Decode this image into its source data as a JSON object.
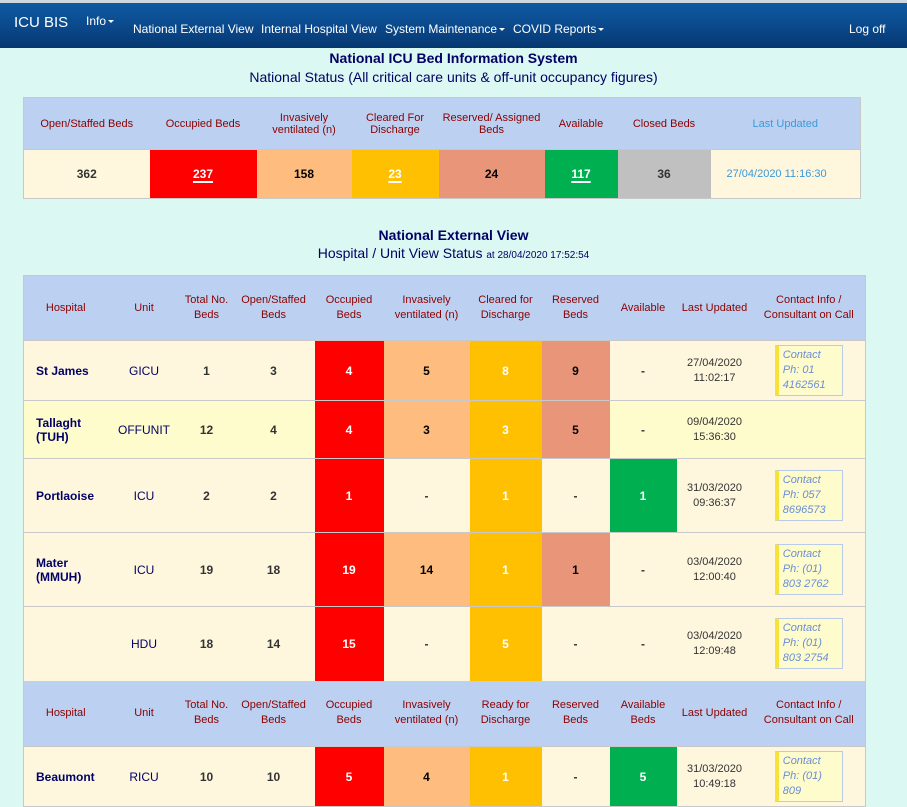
{
  "nav": {
    "brand": "ICU BIS",
    "items": [
      {
        "label": "Info",
        "dropdown": true
      },
      {
        "label": "National External View",
        "dropdown": false
      },
      {
        "label": "Internal Hospital View",
        "dropdown": false
      },
      {
        "label": "System Maintenance",
        "dropdown": true
      },
      {
        "label": "COVID Reports",
        "dropdown": true
      }
    ],
    "logoff": "Log off"
  },
  "national": {
    "title": "National ICU Bed Information System",
    "subtitle": "National Status (All critical care units & off-unit occupancy figures)",
    "headers": {
      "open_staffed": "Open/Staffed Beds",
      "occupied": "Occupied Beds",
      "ventilated": "Invasively ventilated (n)",
      "cleared": "Cleared For Discharge",
      "reserved": "Reserved/ Assigned Beds",
      "available": "Available",
      "closed": "Closed Beds",
      "last_updated": "Last Updated"
    },
    "values": {
      "open_staffed": "362",
      "occupied": "237",
      "ventilated": "158",
      "cleared": "23",
      "reserved": "24",
      "available": "117",
      "closed": "36",
      "last_updated": "27/04/2020 11:16:30"
    }
  },
  "external": {
    "title": "National External View",
    "subtitle": "Hospital / Unit View Status",
    "timestamp": "at 28/04/2020 17:52:54",
    "headers1": [
      "Hospital",
      "Unit",
      "Total No. Beds",
      "Open/Staffed Beds",
      "Occupied Beds",
      "Invasively ventilated (n)",
      "Cleared for Discharge",
      "Reserved Beds",
      "Available",
      "Last Updated",
      "Contact Info / Consultant on Call"
    ],
    "headers2": [
      "Hospital",
      "Unit",
      "Total No. Beds",
      "Open/Staffed Beds",
      "Occupied Beds",
      "Invasively ventilated (n)",
      "Ready for Discharge",
      "Reserved Beds",
      "Available Beds",
      "Last Updated",
      "Contact Info / Consultant on Call"
    ],
    "rows": [
      {
        "hospital": "St James",
        "unit": "GICU",
        "total": "1",
        "open": "3",
        "occupied": "4",
        "ventilated": "5",
        "cleared": "8",
        "reserved": "9",
        "available": "-",
        "updated_date": "27/04/2020",
        "updated_time": "11:02:17",
        "contact": "Contact Ph: 01 4162561"
      },
      {
        "hospital": "Tallaght (TUH)",
        "unit": "OFFUNIT",
        "total": "12",
        "open": "4",
        "occupied": "4",
        "ventilated": "3",
        "cleared": "3",
        "reserved": "5",
        "available": "-",
        "updated_date": "09/04/2020",
        "updated_time": "15:36:30",
        "contact": ""
      },
      {
        "hospital": "Portlaoise",
        "unit": "ICU",
        "total": "2",
        "open": "2",
        "occupied": "1",
        "ventilated": "-",
        "cleared": "1",
        "reserved": "-",
        "available": "1",
        "updated_date": "31/03/2020",
        "updated_time": "09:36:37",
        "contact": "Contact Ph: 057 8696573"
      },
      {
        "hospital": "Mater (MMUH)",
        "unit": "ICU",
        "total": "19",
        "open": "18",
        "occupied": "19",
        "ventilated": "14",
        "cleared": "1",
        "reserved": "1",
        "available": "-",
        "updated_date": "03/04/2020",
        "updated_time": "12:00:40",
        "contact": "Contact Ph: (01) 803 2762"
      },
      {
        "hospital": "",
        "unit": "HDU",
        "total": "18",
        "open": "14",
        "occupied": "15",
        "ventilated": "-",
        "cleared": "5",
        "reserved": "-",
        "available": "-",
        "updated_date": "03/04/2020",
        "updated_time": "12:09:48",
        "contact": "Contact Ph: (01) 803 2754"
      },
      {
        "hospital": "Beaumont",
        "unit": "RICU",
        "total": "10",
        "open": "10",
        "occupied": "5",
        "ventilated": "4",
        "cleared": "1",
        "reserved": "-",
        "available": "5",
        "updated_date": "31/03/2020",
        "updated_time": "10:49:18",
        "contact": "Contact Ph: (01) 809"
      }
    ]
  }
}
